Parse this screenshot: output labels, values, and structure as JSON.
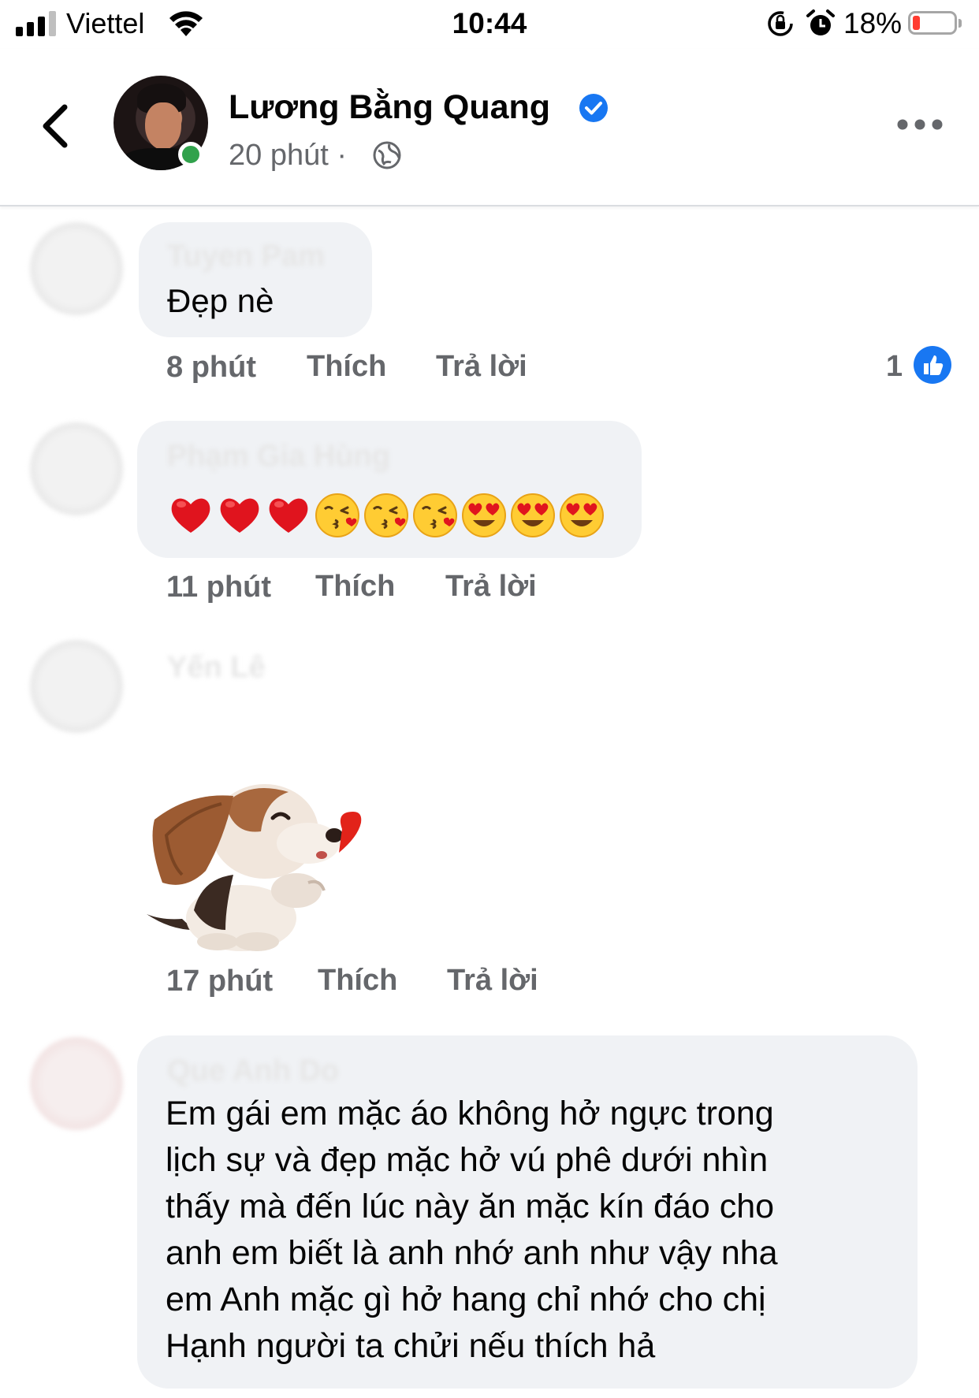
{
  "status_bar": {
    "carrier": "Viettel",
    "time": "10:44",
    "battery_percent": "18%",
    "battery_level": 0.18,
    "icons": [
      "signal-icon",
      "wifi-icon",
      "orientation-lock-icon",
      "alarm-icon",
      "battery-icon"
    ]
  },
  "header": {
    "author_name": "Lương Bằng Quang",
    "post_time": "20 phút ·",
    "icons": [
      "back-icon",
      "verified-icon",
      "globe-icon",
      "more-icon"
    ]
  },
  "comments": [
    {
      "name": "Tuyen Pam",
      "text": "Đẹp nè",
      "time": "8 phút",
      "like_label": "Thích",
      "reply_label": "Trả lời",
      "reaction_count": "1"
    },
    {
      "name": "Phạm Gia Hùng",
      "emojis": [
        "heart",
        "heart",
        "heart",
        "kiss",
        "kiss",
        "kiss",
        "heart-eyes",
        "heart-eyes",
        "heart-eyes"
      ],
      "time": "11 phút",
      "like_label": "Thích",
      "reply_label": "Trả lời"
    },
    {
      "name": "Yến Lê",
      "sticker": "dog-blowing-heart-sticker",
      "time": "17 phút",
      "like_label": "Thích",
      "reply_label": "Trả lời"
    },
    {
      "name": "Que Anh Do",
      "text": "Em gái em mặc áo không hở ngực trong\nlịch sự và đẹp mặc hở vú phê dưới nhìn\nthấy mà đến lúc này ăn mặc kín đáo cho\nanh em biết là anh nhớ anh như vậy nha\nem Anh mặc gì hở hang chỉ nhớ cho chị\nHạnh người ta chửi nếu thích hả"
    }
  ],
  "colors": {
    "accent": "#1877f2",
    "online": "#31a24c",
    "bubble": "#f0f2f5",
    "meta_text": "#65676b",
    "battery_low": "#ff3b30"
  }
}
